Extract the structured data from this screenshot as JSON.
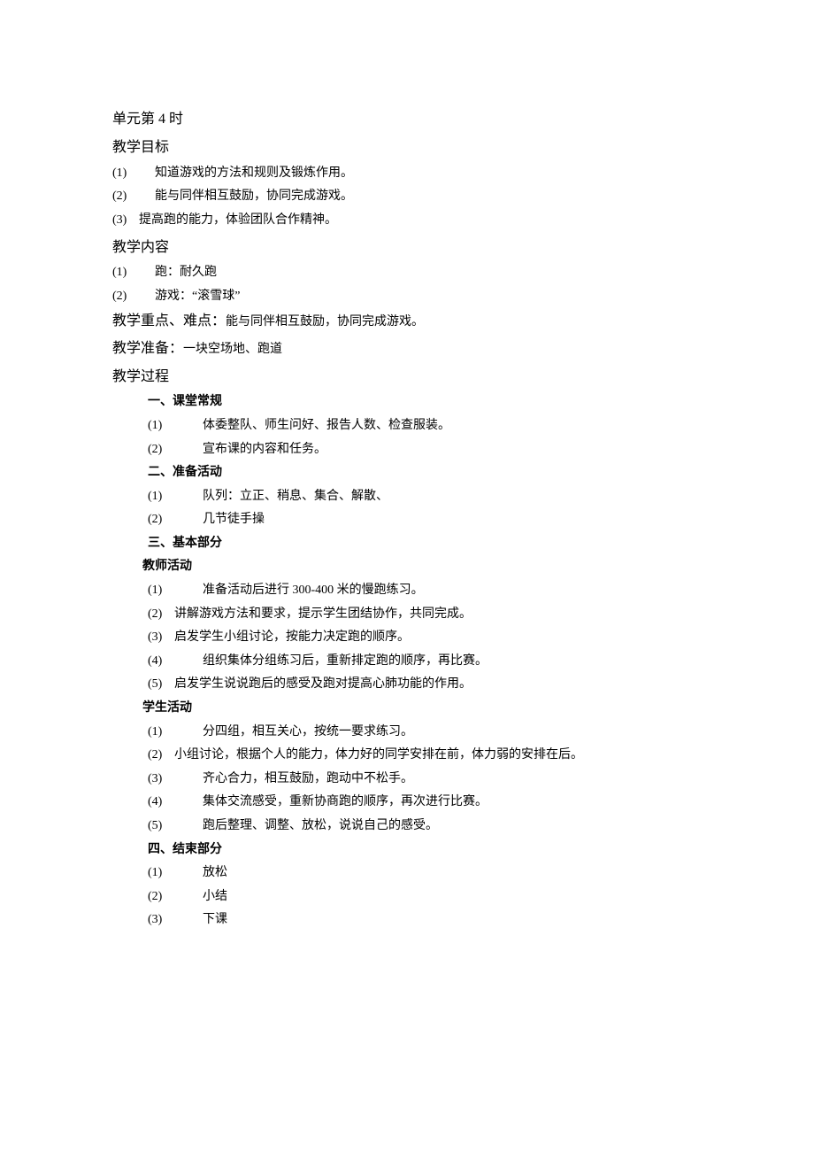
{
  "unit_title": "单元第 4 时",
  "goals": {
    "heading": "教学目标",
    "items": [
      {
        "num": "(1)",
        "text": "知道游戏的方法和规则及锻炼作用。"
      },
      {
        "num": "(2)",
        "text": "能与同伴相互鼓励，协同完成游戏。"
      },
      {
        "num": "(3)",
        "text": "提高跑的能力，体验团队合作精神。"
      }
    ]
  },
  "content": {
    "heading": "教学内容",
    "items": [
      {
        "num": "(1)",
        "text": "跑：耐久跑"
      },
      {
        "num": "(2)",
        "text": "游戏：“滚雪球”"
      }
    ]
  },
  "focus": {
    "label": "教学重点、难点：",
    "text": "能与同伴相互鼓励，协同完成游戏。"
  },
  "prep": {
    "label": "教学准备：",
    "text": "一块空场地、跑道"
  },
  "process_heading": "教学过程",
  "routine": {
    "heading": "一、课堂常规",
    "items": [
      {
        "num": "(1)",
        "text": "体委整队、师生问好、报告人数、检查服装。"
      },
      {
        "num": "(2)",
        "text": "宣布课的内容和任务。"
      }
    ]
  },
  "warmup": {
    "heading": "二、准备活动",
    "items": [
      {
        "num": "(1)",
        "text": "队列：立正、稍息、集合、解散、"
      },
      {
        "num": "(2)",
        "text": "几节徒手操"
      }
    ]
  },
  "main": {
    "heading": "三、基本部分",
    "teacher_label": "教师活动",
    "teacher_items": [
      {
        "num": "(1)",
        "text": "准备活动后进行 300-400 米的慢跑练习。",
        "wide": true
      },
      {
        "num": "(2)",
        "text": "讲解游戏方法和要求，提示学生团结协作，共同完成。",
        "wide": false
      },
      {
        "num": "(3)",
        "text": "启发学生小组讨论，按能力决定跑的顺序。",
        "wide": false
      },
      {
        "num": "(4)",
        "text": "组织集体分组练习后，重新排定跑的顺序，再比赛。",
        "wide": true
      },
      {
        "num": "(5)",
        "text": "启发学生说说跑后的感受及跑对提高心肺功能的作用。",
        "wide": false
      }
    ],
    "student_label": "学生活动",
    "student_items": [
      {
        "num": "(1)",
        "text": "分四组，相互关心，按统一要求练习。",
        "wide": true
      },
      {
        "num": "(2)",
        "text": "小组讨论，根据个人的能力，体力好的同学安排在前，体力弱的安排在后。",
        "wide": false
      },
      {
        "num": "(3)",
        "text": "齐心合力，相互鼓励，跑动中不松手。",
        "wide": true
      },
      {
        "num": "(4)",
        "text": "集体交流感受，重新协商跑的顺序，再次进行比赛。",
        "wide": true
      },
      {
        "num": "(5)",
        "text": "跑后整理、调整、放松，说说自己的感受。",
        "wide": true
      }
    ]
  },
  "ending": {
    "heading": "四、结束部分",
    "items": [
      {
        "num": "(1)",
        "text": "放松"
      },
      {
        "num": "(2)",
        "text": "小结"
      },
      {
        "num": "(3)",
        "text": "下课"
      }
    ]
  }
}
